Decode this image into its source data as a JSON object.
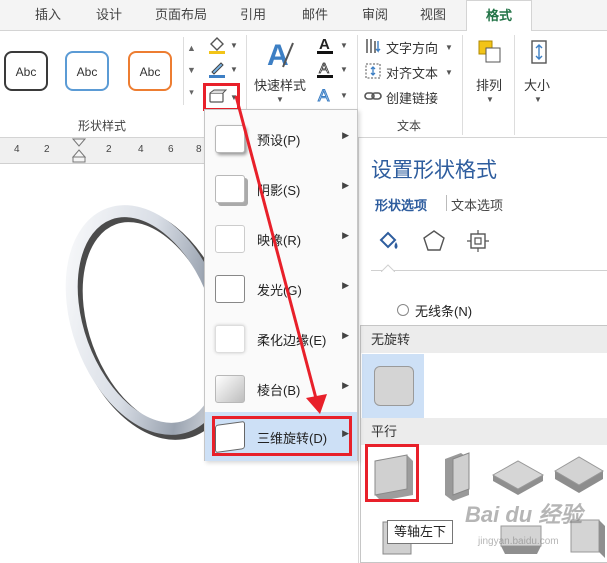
{
  "tabs": [
    {
      "label": "插入"
    },
    {
      "label": "设计"
    },
    {
      "label": "页面布局"
    },
    {
      "label": "引用"
    },
    {
      "label": "邮件"
    },
    {
      "label": "审阅"
    },
    {
      "label": "视图"
    },
    {
      "label": "格式"
    }
  ],
  "ribbon": {
    "shape_styles": {
      "buttons": [
        {
          "label": "Abc",
          "border": "#3a3a3a"
        },
        {
          "label": "Abc",
          "border": "#5b9bd5"
        },
        {
          "label": "Abc",
          "border": "#ed7d31"
        }
      ],
      "group_label": "形状样式"
    },
    "wordart": {
      "quick_styles_label": "快速样式"
    },
    "text": {
      "text_direction": "文字方向",
      "align_text": "对齐文本",
      "create_link": "创建链接",
      "group_label": "文本"
    },
    "arrange": {
      "label": "排列"
    },
    "size": {
      "label": "大小"
    }
  },
  "ruler": {
    "numbers": [
      "4",
      "2",
      "2",
      "4",
      "6",
      "8"
    ]
  },
  "effects_menu": {
    "items": [
      {
        "label": "预设(P)"
      },
      {
        "label": "阴影(S)"
      },
      {
        "label": "映像(R)"
      },
      {
        "label": "发光(G)"
      },
      {
        "label": "柔化边缘(E)"
      },
      {
        "label": "棱台(B)"
      },
      {
        "label": "三维旋转(D)"
      }
    ]
  },
  "format_pane": {
    "title": "设置形状格式",
    "tabs": [
      "形状选项",
      "文本选项"
    ],
    "no_line_option": "无线条(N)"
  },
  "rotation_submenu": {
    "sections": [
      {
        "header": "无旋转"
      },
      {
        "header": "平行"
      }
    ]
  },
  "tooltip": "等轴左下",
  "watermark": {
    "main": "Bai du 经验",
    "sub": "jingyan.baidu.com"
  },
  "colors": {
    "accent_red": "#e8202a",
    "highlight": "#cde0f6",
    "active_tab": "#217346"
  }
}
